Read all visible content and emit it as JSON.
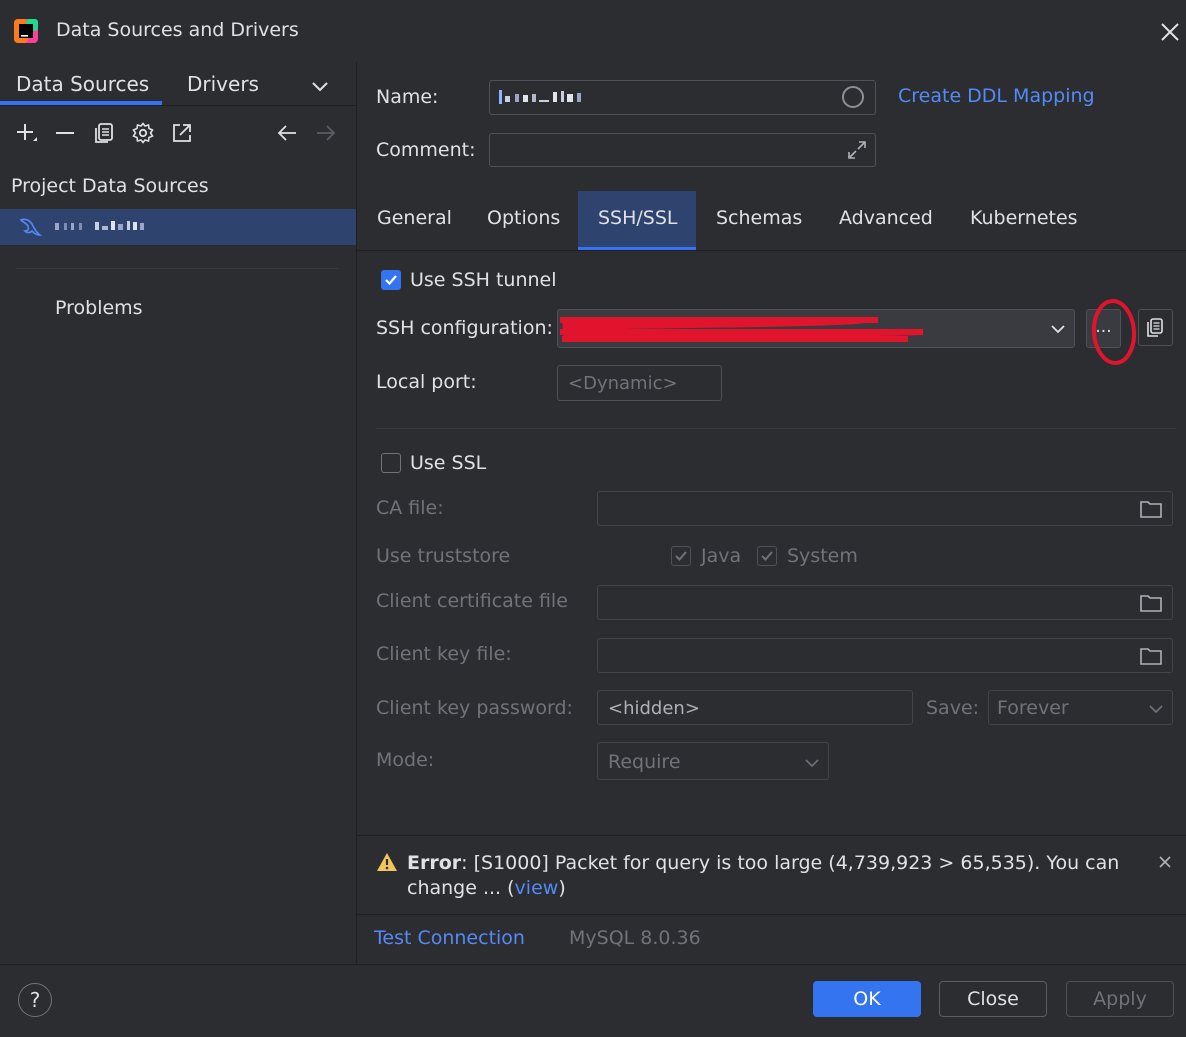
{
  "window": {
    "title": "Data Sources and Drivers"
  },
  "left_tabs": {
    "data_sources": "Data Sources",
    "drivers": "Drivers"
  },
  "left": {
    "section_title": "Project Data Sources",
    "problems": "Problems"
  },
  "form": {
    "name_label": "Name:",
    "create_ddl": "Create DDL Mapping",
    "comment_label": "Comment:"
  },
  "tabs": [
    "General",
    "Options",
    "SSH/SSL",
    "Schemas",
    "Advanced",
    "Kubernetes"
  ],
  "ssh": {
    "use_tunnel": "Use SSH tunnel",
    "config_label": "SSH configuration:",
    "more": "...",
    "local_port_label": "Local port:",
    "local_port_placeholder": "<Dynamic>"
  },
  "ssl": {
    "use_ssl": "Use SSL",
    "ca_file": "CA file:",
    "use_truststore": "Use truststore",
    "java": "Java",
    "system": "System",
    "client_cert": "Client certificate file",
    "client_key": "Client key file:",
    "client_key_password": "Client key password:",
    "password_value": "<hidden>",
    "save_label": "Save:",
    "save_value": "Forever",
    "mode_label": "Mode:",
    "mode_value": "Require"
  },
  "error": {
    "prefix": "Error",
    "message": "[S1000] Packet for query is too large (4,739,923 > 65,535). You can change ... (",
    "link": "view",
    "suffix": ")"
  },
  "footer": {
    "test_connection": "Test Connection",
    "driver_version": "MySQL 8.0.36"
  },
  "buttons": {
    "help": "?",
    "ok": "OK",
    "close": "Close",
    "apply": "Apply"
  },
  "colors": {
    "accent": "#3574f0",
    "link": "#548af7",
    "selection": "#2e436e",
    "annotation_red": "#e0142c"
  }
}
